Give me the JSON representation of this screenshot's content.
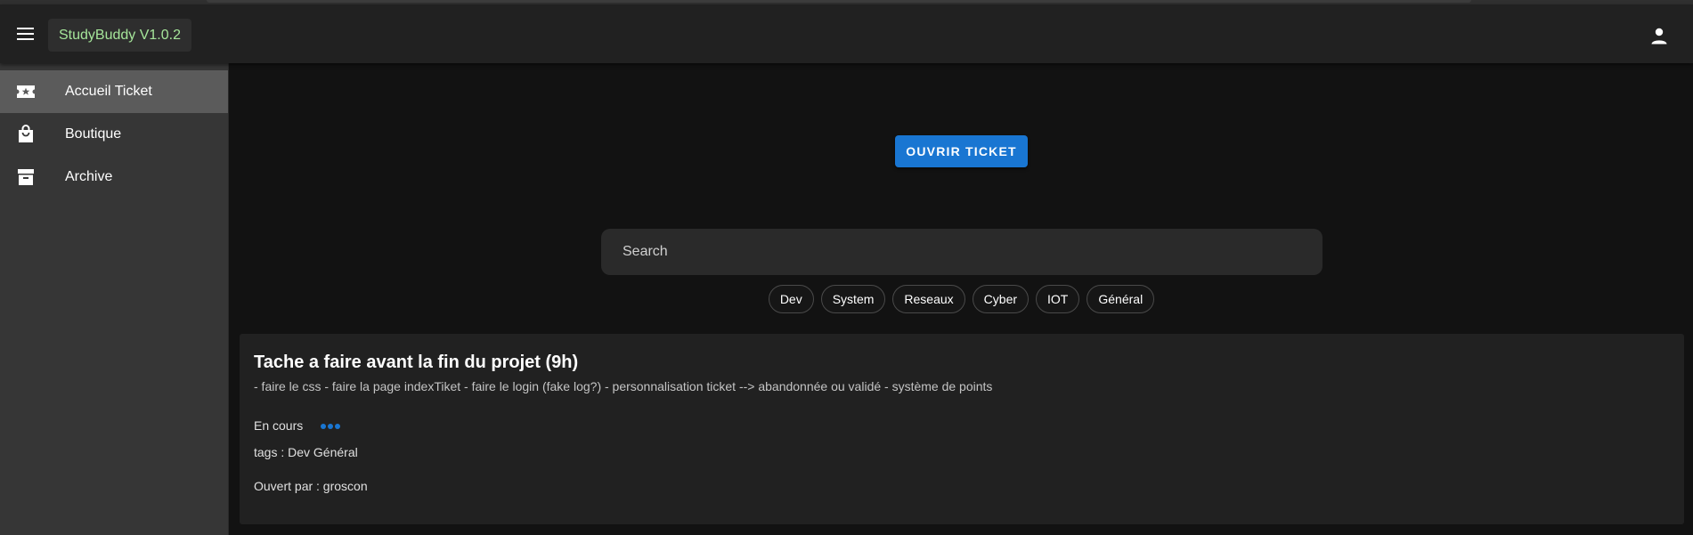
{
  "app": {
    "title": "StudyBuddy V1.0.2",
    "accent": "#1976d2",
    "brand_color": "#a5e59a"
  },
  "sidebar": {
    "items": [
      {
        "label": "Accueil Ticket",
        "icon": "ticket-icon",
        "active": true
      },
      {
        "label": "Boutique",
        "icon": "shopping-bag-icon",
        "active": false
      },
      {
        "label": "Archive",
        "icon": "archive-box-icon",
        "active": false
      }
    ]
  },
  "main": {
    "open_ticket_label": "OUVRIR TICKET",
    "search": {
      "placeholder": "Search",
      "value": ""
    },
    "tag_chips": [
      "Dev",
      "System",
      "Reseaux",
      "Cyber",
      "IOT",
      "Général"
    ]
  },
  "ticket": {
    "title": "Tache a faire avant la fin du projet (9h)",
    "description": "- faire le css - faire la page indexTiket - faire le login (fake log?) - personnalisation ticket --> abandonnée ou validé - système de points",
    "status": "En cours",
    "tags": "tags : Dev Général",
    "opened_by": "Ouvert par : groscon"
  }
}
